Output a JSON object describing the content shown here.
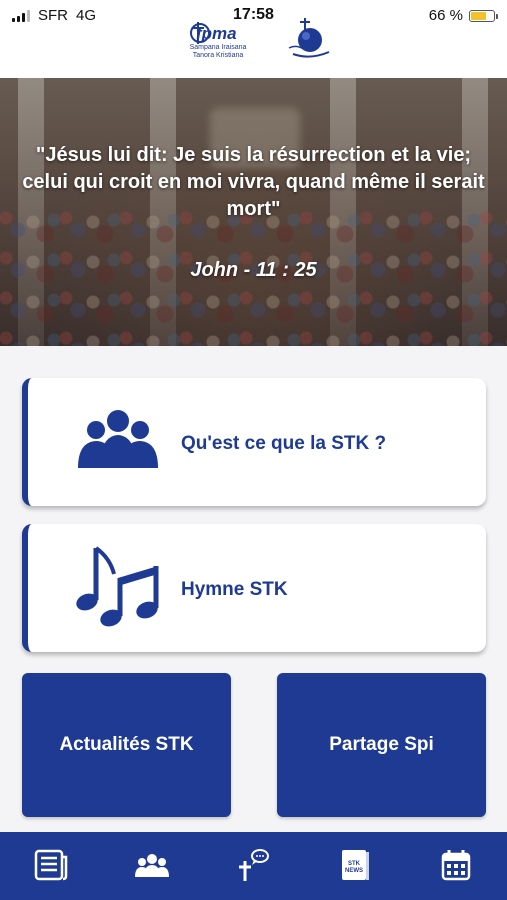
{
  "status_bar": {
    "carrier": "SFR",
    "network": "4G",
    "time": "17:58",
    "battery_percent": "66 %",
    "battery_level": 0.66
  },
  "header": {
    "logo_text": "fpma",
    "logo_tagline_1": "Sampana Iraisana",
    "logo_tagline_2": "Tanora Kristiana"
  },
  "hero": {
    "quote": "\"Jésus lui dit: Je suis la résurrection et la vie; celui qui croit en moi vivra, quand même il serait mort\"",
    "reference": "John - 11 : 25"
  },
  "menu": {
    "about_label": "Qu'est ce que la STK ?",
    "about_icon": "group-icon",
    "hymn_label": "Hymne STK",
    "hymn_icon": "music-notes-icon",
    "news_label": "Actualités STK",
    "share_label": "Partage Spi"
  },
  "tabbar": {
    "tabs": [
      {
        "icon": "news-document-icon"
      },
      {
        "icon": "group-icon"
      },
      {
        "icon": "cross-chat-icon"
      },
      {
        "icon": "stk-news-book-icon",
        "text": "STK NEWS"
      },
      {
        "icon": "calendar-icon"
      }
    ]
  },
  "colors": {
    "primary": "#1f3a93",
    "background": "#f4f4f6",
    "battery": "#f2c32b"
  }
}
